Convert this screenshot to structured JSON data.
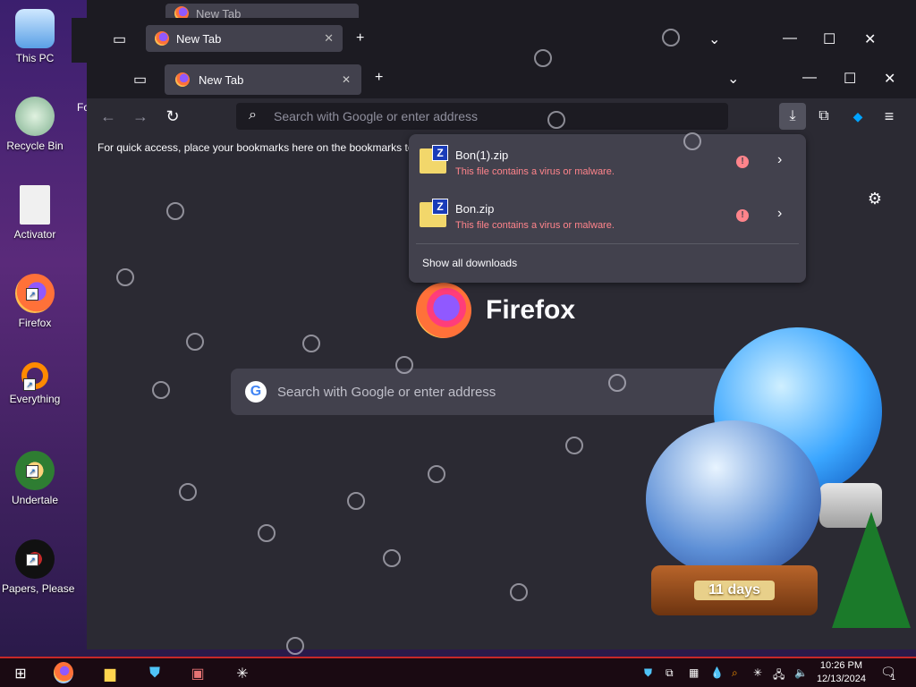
{
  "desktop": {
    "icons": [
      {
        "label": "This PC"
      },
      {
        "label": "Recycle Bin"
      },
      {
        "label": "Activator"
      },
      {
        "label": "Firefox"
      },
      {
        "label": "Everything"
      },
      {
        "label": "Undertale"
      },
      {
        "label": "Papers, Please"
      }
    ]
  },
  "ghost_windows": {
    "back_tab_label": "New Tab",
    "mid_tab_label": "New Tab"
  },
  "browser": {
    "tab_label": "New Tab",
    "new_tab_symbol": "+",
    "list_all_tabs_symbol": "⌄",
    "window_controls": {
      "minimize": "—",
      "maximize": "☐",
      "close": "✕"
    },
    "nav": {
      "back": "←",
      "forward": "→",
      "reload": "↻"
    },
    "url_placeholder": "Search with Google or enter address",
    "bookmarks_hint": "For quick access, place your bookmarks here on the bookmarks to",
    "left_partial_text": "Fo",
    "logo_text": "Firefox",
    "search_placeholder": "Search with Google or enter address",
    "google_letter": "G"
  },
  "downloads_panel": {
    "items": [
      {
        "name": "Bon(1).zip",
        "status": "This file contains a virus or malware."
      },
      {
        "name": "Bon.zip",
        "status": "This file contains a virus or malware."
      }
    ],
    "zip_badge": "Z",
    "warning_symbol": "!",
    "chevron": "›",
    "show_all": "Show all downloads"
  },
  "decor": {
    "globe_label": "11 days"
  },
  "taskbar": {
    "time": "10:26 PM",
    "date": "12/13/2024",
    "notification_count": "1"
  },
  "colors": {
    "warning": "#ff848b",
    "panel": "#42414d",
    "toolbar": "#2b2a33"
  }
}
